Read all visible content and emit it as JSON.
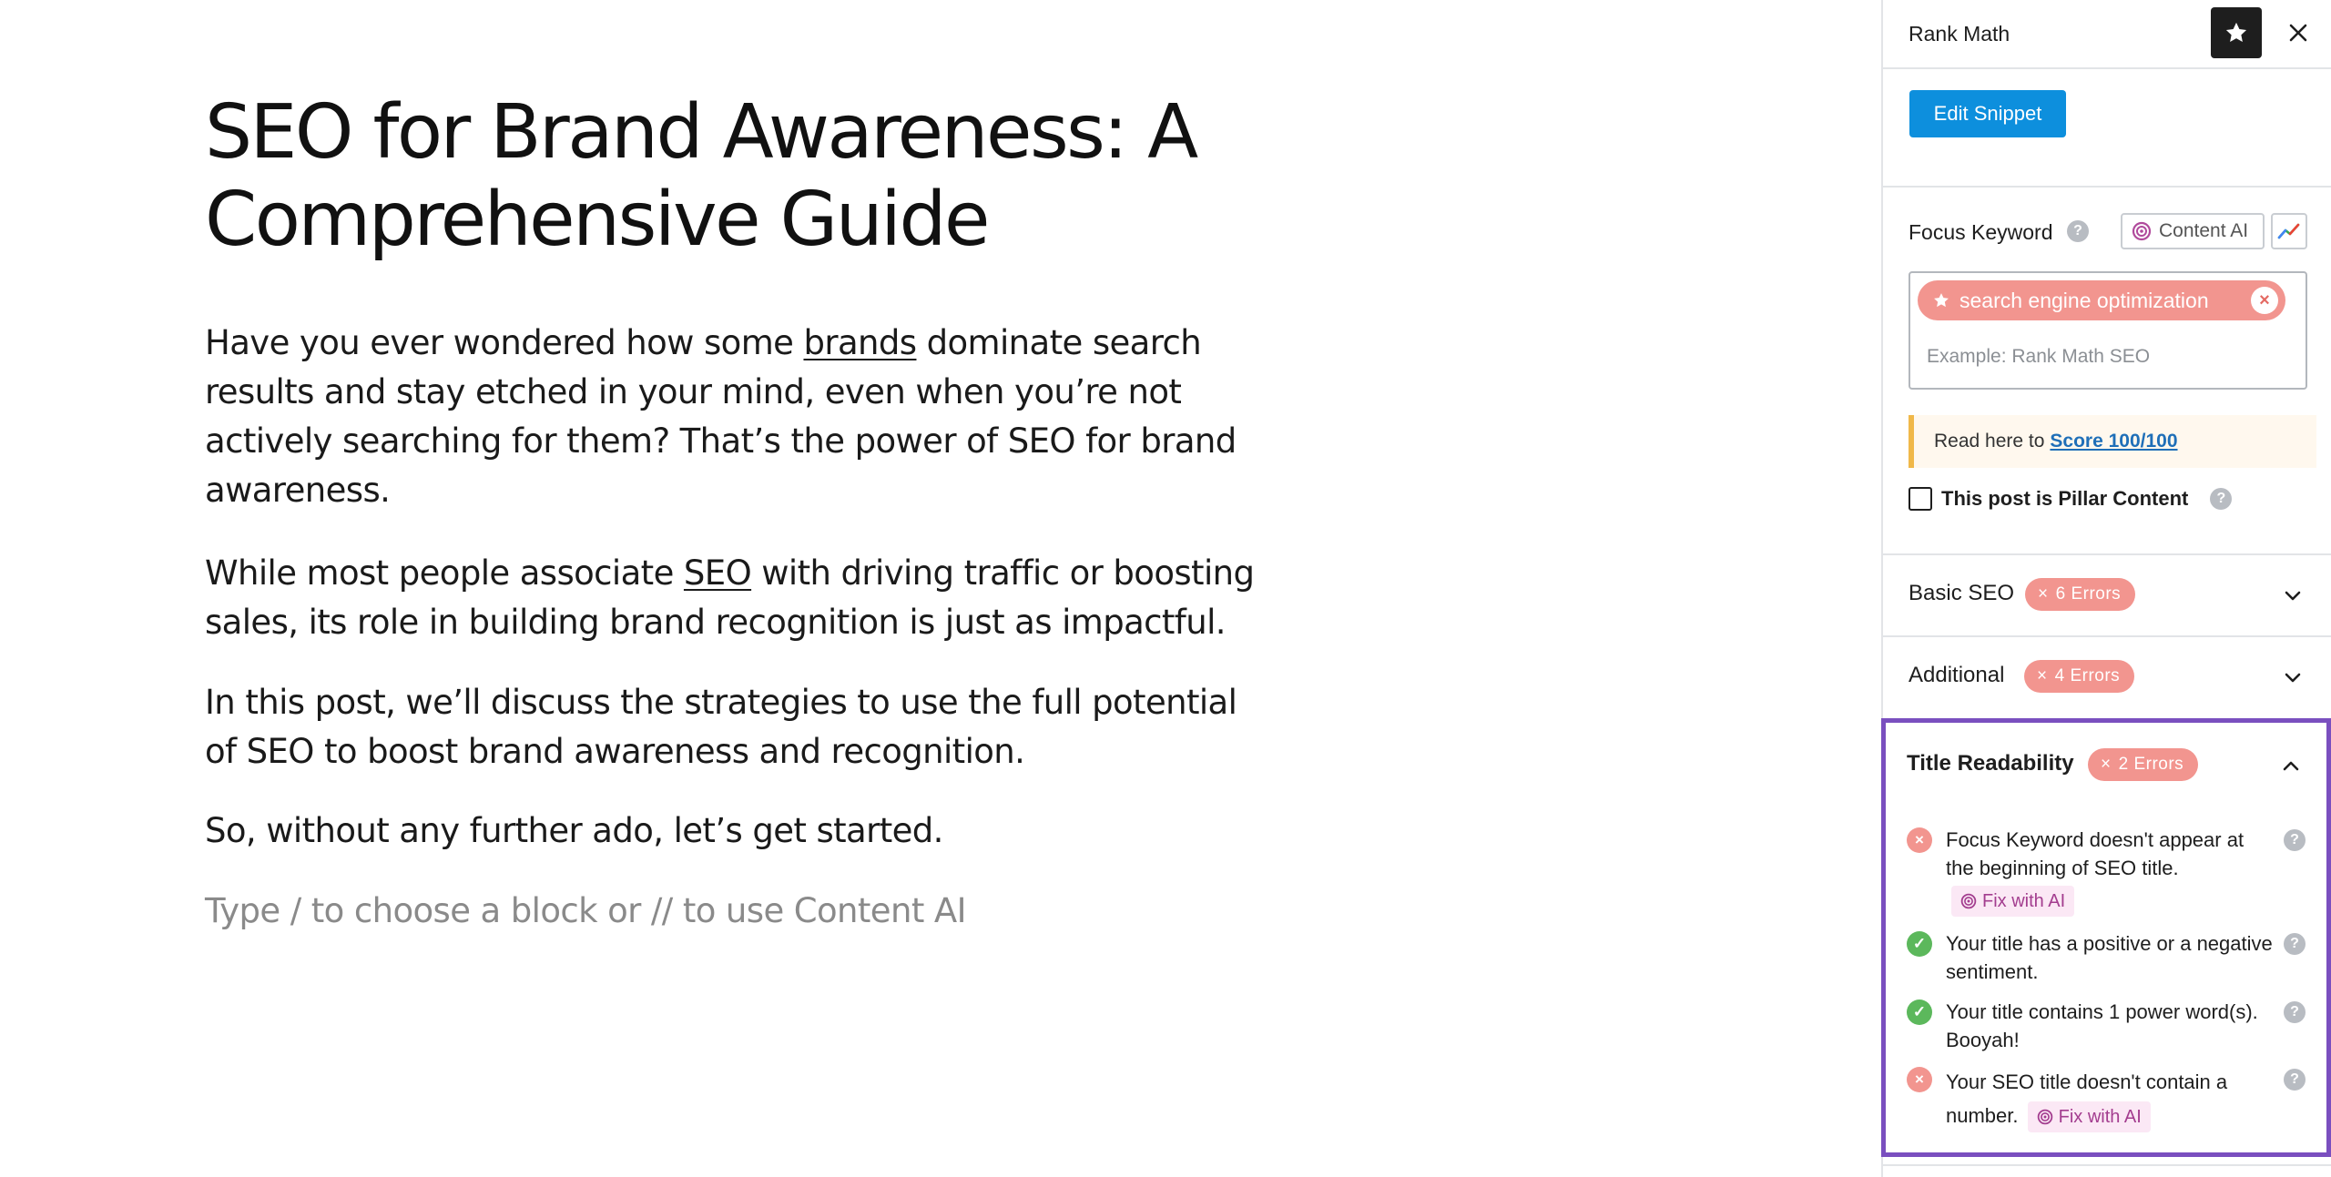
{
  "editor": {
    "title": "SEO for Brand Awareness: A Comprehensive Guide",
    "paragraphs": {
      "p1_before": "Have you ever wondered how some ",
      "p1_link": "brands",
      "p1_after": " dominate search results and stay etched in your mind, even when you’re not actively searching for them? That’s the power of SEO for brand awareness.",
      "p2_before": "While most people associate ",
      "p2_link": "SEO",
      "p2_after": " with driving traffic or boosting sales, its role in building brand recognition is just as impactful.",
      "p3": "In this post, we’ll discuss the strategies to use the full potential of SEO to boost brand awareness and recognition.",
      "p4": "So, without any further ado, let’s get started."
    },
    "block_placeholder": "Type / to choose a block or // to use Content AI"
  },
  "sidebar": {
    "title": "Rank Math",
    "edit_snippet": "Edit Snippet",
    "focus_keyword": {
      "label": "Focus Keyword",
      "content_ai": "Content AI",
      "keyword": "search engine optimization",
      "placeholder": "Example: Rank Math SEO"
    },
    "notice": {
      "text": "Read here to",
      "link": "Score 100/100"
    },
    "pillar_label": "This post is Pillar Content",
    "panels": {
      "basic": {
        "title": "Basic SEO",
        "badge": "6 Errors"
      },
      "additional": {
        "title": "Additional",
        "badge": "4 Errors"
      },
      "title_readability": {
        "title": "Title Readability",
        "badge": "2 Errors",
        "items": [
          {
            "status": "error",
            "text": "Focus Keyword doesn't appear at the beginning of SEO title.",
            "fix": "Fix with AI"
          },
          {
            "status": "ok",
            "text": "Your title has a positive or a negative sentiment."
          },
          {
            "status": "ok",
            "text": "Your title contains 1 power word(s). Booyah!"
          },
          {
            "status": "error",
            "text": "Your SEO title doesn't contain a number.",
            "fix": "Fix with AI"
          }
        ]
      }
    },
    "colors": {
      "accent": "#0d8fdd",
      "error": "#f2958f",
      "ok": "#5cb85c",
      "highlight": "#7a4fbf"
    }
  }
}
